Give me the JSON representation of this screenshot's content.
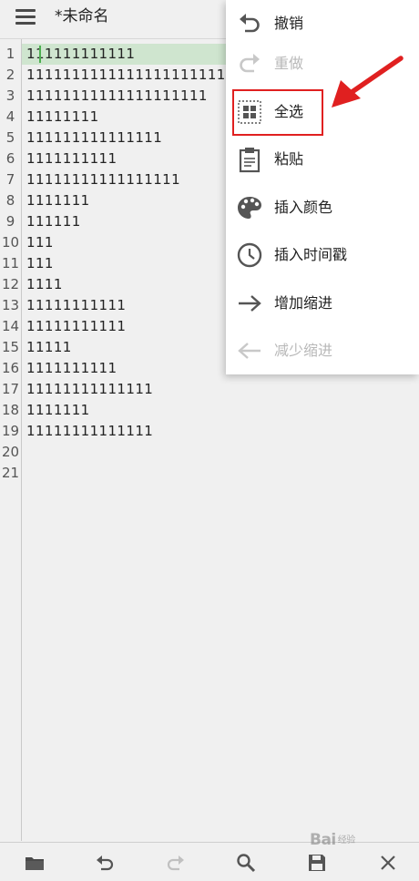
{
  "header": {
    "title": "*未命名"
  },
  "editor": {
    "lines": [
      {
        "num": "1",
        "text": "111111111111"
      },
      {
        "num": "2",
        "text": "1111111111111111111111111"
      },
      {
        "num": "3",
        "text": "11111111111111111111"
      },
      {
        "num": "4",
        "text": "11111111"
      },
      {
        "num": "5",
        "text": "111111111111111"
      },
      {
        "num": "6",
        "text": "1111111111"
      },
      {
        "num": "7",
        "text": "11111111111111111"
      },
      {
        "num": "8",
        "text": "1111111"
      },
      {
        "num": "9",
        "text": "111111"
      },
      {
        "num": "10",
        "text": "111"
      },
      {
        "num": "11",
        "text": "111"
      },
      {
        "num": "12",
        "text": "1111"
      },
      {
        "num": "13",
        "text": "11111111111"
      },
      {
        "num": "14",
        "text": "11111111111"
      },
      {
        "num": "15",
        "text": "11111"
      },
      {
        "num": "16",
        "text": "1111111111"
      },
      {
        "num": "17",
        "text": "11111111111111"
      },
      {
        "num": "18",
        "text": "1111111"
      },
      {
        "num": "19",
        "text": "11111111111111"
      },
      {
        "num": "20",
        "text": ""
      },
      {
        "num": "21",
        "text": ""
      }
    ],
    "current_line": 1,
    "current_line_color": "#cfe5cf"
  },
  "menu": {
    "items": [
      {
        "label": "撤销",
        "icon": "undo-icon",
        "enabled": true
      },
      {
        "label": "重做",
        "icon": "redo-icon",
        "enabled": false
      },
      {
        "label": "全选",
        "icon": "select-all-icon",
        "enabled": true
      },
      {
        "label": "粘贴",
        "icon": "paste-icon",
        "enabled": true
      },
      {
        "label": "插入颜色",
        "icon": "palette-icon",
        "enabled": true
      },
      {
        "label": "插入时间戳",
        "icon": "clock-icon",
        "enabled": true
      },
      {
        "label": "增加缩进",
        "icon": "indent-icon",
        "enabled": true
      },
      {
        "label": "减少缩进",
        "icon": "outdent-icon",
        "enabled": false
      }
    ]
  },
  "annotation": {
    "highlight_color": "#e02020"
  },
  "bottombar": {
    "icons": [
      "folder-icon",
      "undo-icon",
      "redo-icon",
      "search-icon",
      "save-icon",
      "close-icon"
    ]
  },
  "watermark": {
    "text": "Bai",
    "suffix": "经验"
  }
}
